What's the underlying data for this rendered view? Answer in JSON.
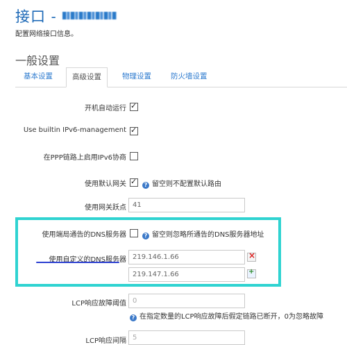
{
  "header": {
    "title": "接口 -",
    "redacted_name_shown": true,
    "subtitle": "配置网络接口信息。"
  },
  "section_title": "一般设置",
  "tabs": [
    {
      "label": "基本设置",
      "active": false
    },
    {
      "label": "高级设置",
      "active": true
    },
    {
      "label": "物理设置",
      "active": false
    },
    {
      "label": "防火墙设置",
      "active": false
    }
  ],
  "fields": {
    "auto_start": {
      "label": "开机自动运行",
      "checked": true
    },
    "ipv6_mgmt": {
      "label": "Use builtin IPv6-management",
      "checked": true
    },
    "ipv6_ppp": {
      "label": "在PPP链路上启用IPv6协商",
      "checked": false
    },
    "default_gw": {
      "label": "使用默认网关",
      "checked": true,
      "hint": "留空则不配置默认路由"
    },
    "gw_metric": {
      "label": "使用网关跃点",
      "value": "41"
    },
    "peer_dns": {
      "label": "使用端局通告的DNS服务器",
      "checked": false,
      "hint": "留空则忽略所通告的DNS服务器地址"
    },
    "custom_dns": {
      "label": "使用自定义的DNS服务器",
      "values": [
        "219.146.1.66",
        "219.147.1.66"
      ]
    },
    "lcp_threshold": {
      "label": "LCP响应故障阈值",
      "placeholder": "0",
      "hint": "在指定数量的LCP响应故障后假定链路已断开，0为忽略故障"
    },
    "lcp_interval": {
      "label": "LCP响应间隔",
      "placeholder": "5"
    }
  },
  "colors": {
    "accent": "#1a67b6",
    "highlight_box": "#2fd3d1",
    "underline": "#2b3fd1"
  }
}
